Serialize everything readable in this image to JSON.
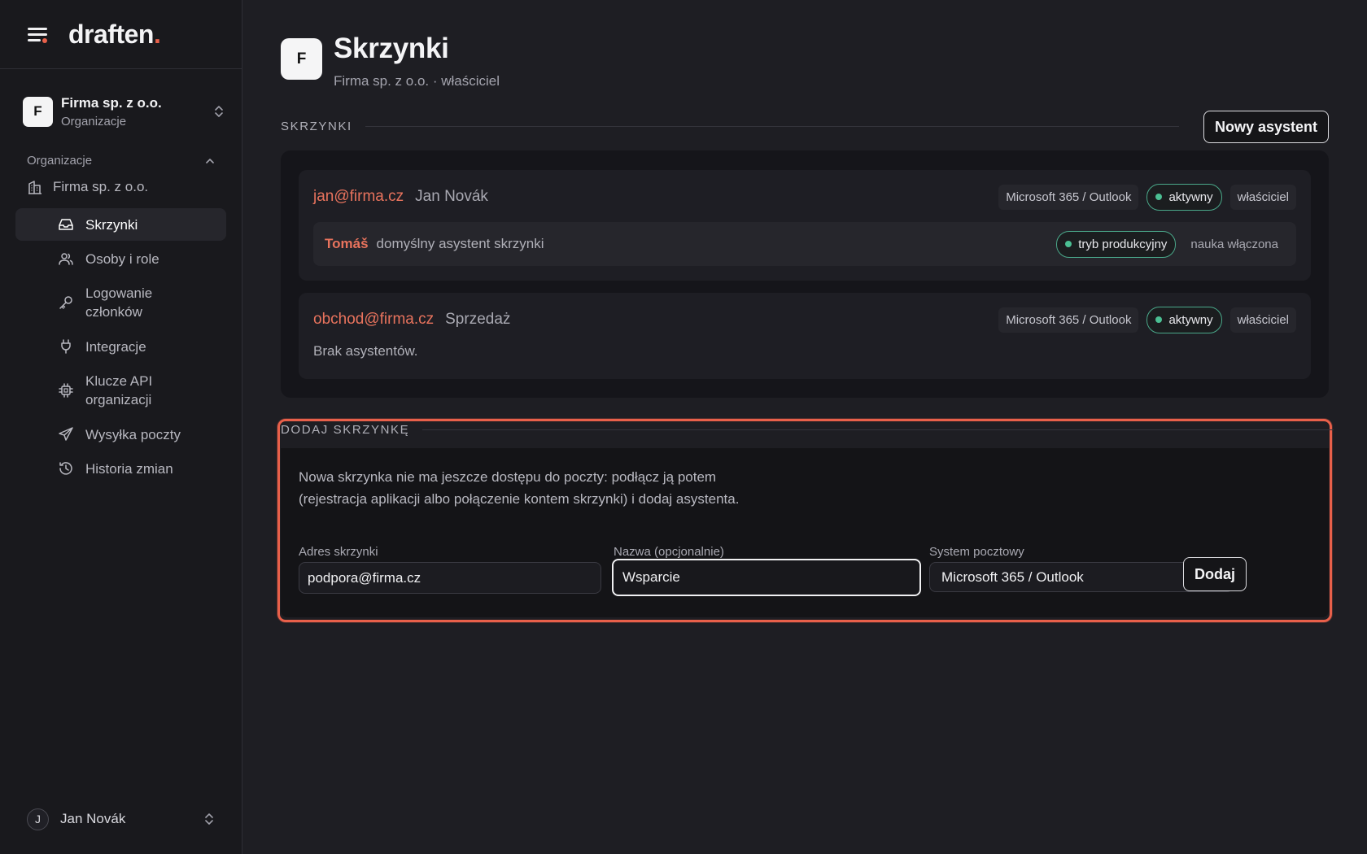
{
  "app": {
    "logo_text": "draften",
    "logo_dot": "."
  },
  "org_switcher": {
    "avatar": "F",
    "name": "Firma sp. z o.o.",
    "subtitle": "Organizacje"
  },
  "sidebar": {
    "section_title": "Organizacje",
    "org_item": "Firma sp. z o.o.",
    "items": [
      {
        "label": "Skrzynki",
        "icon": "inbox-icon",
        "active": true
      },
      {
        "label": "Osoby i role",
        "icon": "users-icon"
      },
      {
        "label": "Logowanie członków",
        "icon": "key-icon"
      },
      {
        "label": "Integracje",
        "icon": "plug-icon"
      },
      {
        "label": "Klucze API organizacji",
        "icon": "chip-icon"
      },
      {
        "label": "Wysyłka poczty",
        "icon": "send-icon"
      },
      {
        "label": "Historia zmian",
        "icon": "history-icon"
      }
    ]
  },
  "user": {
    "avatar": "J",
    "name": "Jan Novák"
  },
  "page": {
    "avatar": "F",
    "title": "Skrzynki",
    "subtitle": "Firma sp. z o.o. · właściciel"
  },
  "mailboxes_section": {
    "label": "SKRZYNKI",
    "new_button": "Nowy asystent"
  },
  "mailboxes": [
    {
      "address": "jan@firma.cz",
      "name": "Jan Novák",
      "provider": "Microsoft 365 / Outlook",
      "status": "aktywny",
      "role": "właściciel",
      "assistant": {
        "name": "Tomáš",
        "description": "domyślny asystent skrzynki",
        "mode": "tryb produkcyjny",
        "learning": "nauka włączona"
      }
    },
    {
      "address": "obchod@firma.cz",
      "name": "Sprzedaż",
      "provider": "Microsoft 365 / Outlook",
      "status": "aktywny",
      "role": "właściciel",
      "empty_text": "Brak asystentów."
    }
  ],
  "add_section": {
    "label": "DODAJ SKRZYNKĘ",
    "description": "Nowa skrzynka nie ma jeszcze dostępu do poczty: podłącz ją potem (rejestracja aplikacji albo połączenie kontem skrzynki) i dodaj asystenta.",
    "address_label": "Adres skrzynki",
    "address_value": "podpora@firma.cz",
    "name_label": "Nazwa (opcjonalnie)",
    "name_value": "Wsparcie",
    "system_label": "System pocztowy",
    "system_value": "Microsoft 365 / Outlook",
    "add_button": "Dodaj"
  },
  "colors": {
    "accent": "#e8604a",
    "link": "#e8735d",
    "status_green": "#4bbf93"
  }
}
